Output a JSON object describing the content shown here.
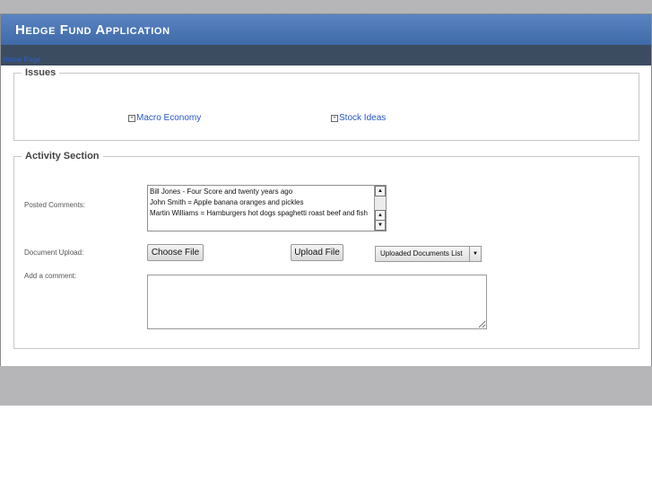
{
  "app": {
    "title": "Hedge Fund Application"
  },
  "nav": {
    "link": "Home Page"
  },
  "issues": {
    "legend": "Issues",
    "items": [
      {
        "label": "Macro Economy",
        "icon": "plus-box-icon"
      },
      {
        "label": "Stock Ideas",
        "icon": "plus-box-icon"
      }
    ]
  },
  "activity": {
    "legend": "Activity Section",
    "posted_comments": {
      "label": "Posted Comments:",
      "items": [
        "Bill Jones - Four Score and twenty years ago",
        "John Smith = Apple banana oranges and pickles",
        "Martin Williams = Hamburgers hot dogs spaghetti roast beef and fish"
      ]
    },
    "document_upload": {
      "label": "Document Upload:",
      "choose_label": "Choose File",
      "upload_label": "Upload File",
      "documents_list": "Uploaded Documents List"
    },
    "add_comment": {
      "label": "Add a comment:",
      "value": ""
    }
  },
  "colors": {
    "header": "#4a77b8",
    "navbar": "#3b4c60",
    "link": "#2657c4",
    "strip": "#b6b6b9"
  }
}
